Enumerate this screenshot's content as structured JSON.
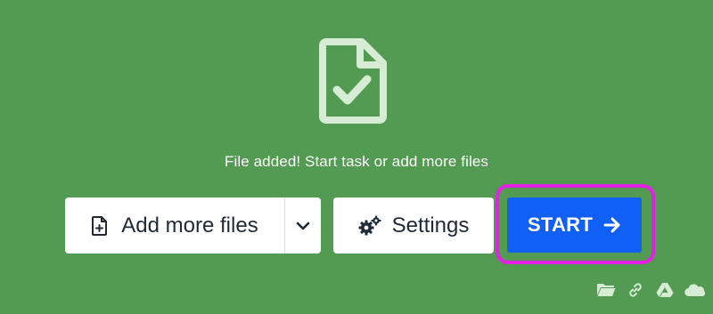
{
  "status": {
    "message": "File added! Start task or add more files",
    "icon": "file-check-icon"
  },
  "toolbar": {
    "add_more_files_label": "Add more files",
    "add_icon": "file-plus-icon",
    "dropdown_icon": "chevron-down-icon",
    "settings_label": "Settings",
    "settings_icon": "gears-icon",
    "start_label": "START",
    "start_icon": "arrow-right-icon"
  },
  "sources": [
    {
      "name": "folder-icon"
    },
    {
      "name": "link-icon"
    },
    {
      "name": "google-drive-icon"
    },
    {
      "name": "onedrive-icon"
    }
  ],
  "colors": {
    "background": "#539a52",
    "start_button": "#1160f6",
    "highlight_outline": "#e61ee6",
    "icon_light": "#d7ecd5"
  }
}
